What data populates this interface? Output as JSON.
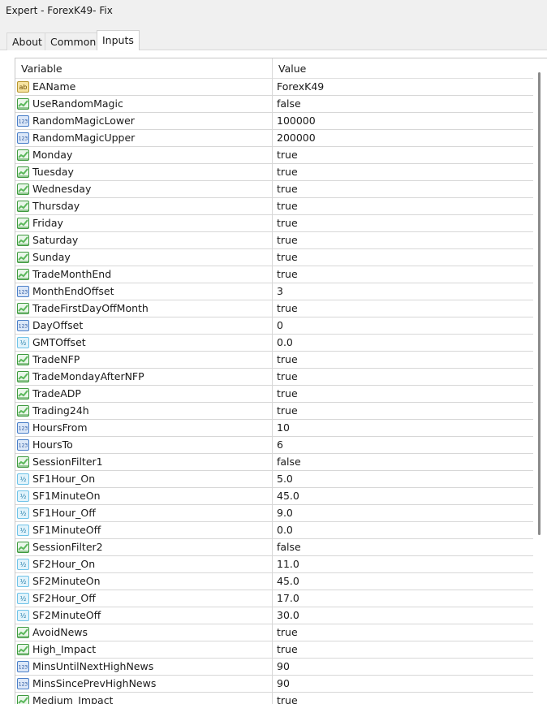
{
  "window": {
    "title": "Expert - ForexK49- Fix"
  },
  "tabs": [
    {
      "label": "About",
      "active": false
    },
    {
      "label": "Common",
      "active": false
    },
    {
      "label": "Inputs",
      "active": true
    }
  ],
  "grid": {
    "headers": {
      "variable": "Variable",
      "value": "Value"
    },
    "rows": [
      {
        "type": "string",
        "name": "EAName",
        "value": "ForexK49"
      },
      {
        "type": "bool",
        "name": "UseRandomMagic",
        "value": "false"
      },
      {
        "type": "int",
        "name": "RandomMagicLower",
        "value": "100000"
      },
      {
        "type": "int",
        "name": "RandomMagicUpper",
        "value": "200000"
      },
      {
        "type": "bool",
        "name": "Monday",
        "value": "true"
      },
      {
        "type": "bool",
        "name": "Tuesday",
        "value": "true"
      },
      {
        "type": "bool",
        "name": "Wednesday",
        "value": "true"
      },
      {
        "type": "bool",
        "name": "Thursday",
        "value": "true"
      },
      {
        "type": "bool",
        "name": "Friday",
        "value": "true"
      },
      {
        "type": "bool",
        "name": "Saturday",
        "value": "true"
      },
      {
        "type": "bool",
        "name": "Sunday",
        "value": "true"
      },
      {
        "type": "bool",
        "name": "TradeMonthEnd",
        "value": "true"
      },
      {
        "type": "int",
        "name": "MonthEndOffset",
        "value": "3"
      },
      {
        "type": "bool",
        "name": "TradeFirstDayOffMonth",
        "value": "true"
      },
      {
        "type": "int",
        "name": "DayOffset",
        "value": "0"
      },
      {
        "type": "double",
        "name": "GMTOffset",
        "value": "0.0"
      },
      {
        "type": "bool",
        "name": "TradeNFP",
        "value": "true"
      },
      {
        "type": "bool",
        "name": "TradeMondayAfterNFP",
        "value": "true"
      },
      {
        "type": "bool",
        "name": "TradeADP",
        "value": "true"
      },
      {
        "type": "bool",
        "name": "Trading24h",
        "value": "true"
      },
      {
        "type": "int",
        "name": "HoursFrom",
        "value": "10"
      },
      {
        "type": "int",
        "name": "HoursTo",
        "value": "6"
      },
      {
        "type": "bool",
        "name": "SessionFilter1",
        "value": "false"
      },
      {
        "type": "double",
        "name": "SF1Hour_On",
        "value": "5.0"
      },
      {
        "type": "double",
        "name": "SF1MinuteOn",
        "value": "45.0"
      },
      {
        "type": "double",
        "name": "SF1Hour_Off",
        "value": "9.0"
      },
      {
        "type": "double",
        "name": "SF1MinuteOff",
        "value": "0.0"
      },
      {
        "type": "bool",
        "name": "SessionFilter2",
        "value": "false"
      },
      {
        "type": "double",
        "name": "SF2Hour_On",
        "value": "11.0"
      },
      {
        "type": "double",
        "name": "SF2MinuteOn",
        "value": "45.0"
      },
      {
        "type": "double",
        "name": "SF2Hour_Off",
        "value": "17.0"
      },
      {
        "type": "double",
        "name": "SF2MinuteOff",
        "value": "30.0"
      },
      {
        "type": "bool",
        "name": "AvoidNews",
        "value": "true"
      },
      {
        "type": "bool",
        "name": "High_Impact",
        "value": "true"
      },
      {
        "type": "int",
        "name": "MinsUntilNextHighNews",
        "value": "90"
      },
      {
        "type": "int",
        "name": "MinsSincePrevHighNews",
        "value": "90"
      },
      {
        "type": "bool",
        "name": "Medium_Impact",
        "value": "true"
      }
    ]
  },
  "icons": {
    "string": {
      "name": "string-type-icon",
      "glyph": "ab"
    },
    "bool": {
      "name": "bool-type-icon",
      "glyph": ""
    },
    "int": {
      "name": "integer-type-icon",
      "glyph": "123"
    },
    "double": {
      "name": "double-type-icon",
      "glyph": "½"
    }
  },
  "colors": {
    "string_icon_fill": "#f6e3a1",
    "bool_icon_fill": "#5cb85c",
    "int_icon_fill": "#4a7fc8",
    "double_icon_fill": "#6fc3e8"
  }
}
